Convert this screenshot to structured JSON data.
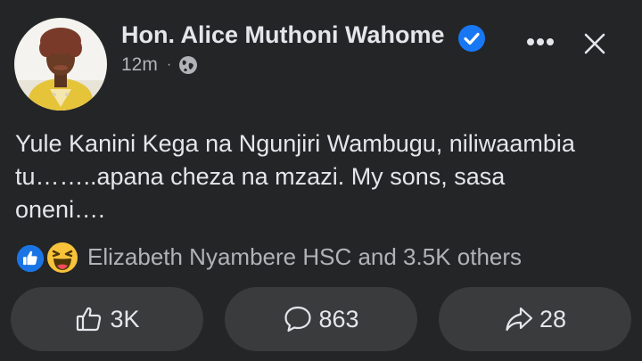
{
  "post": {
    "author": "Hon. Alice Muthoni Wahome",
    "time": "12m",
    "separator": "·",
    "text": "Yule Kanini Kega na Ngunjiri Wambugu, niliwaambia\ntu……..apana cheza na mzazi. My sons, sasa\noneni…."
  },
  "icons": {
    "verified": "verified-badge-icon",
    "privacy": "globe-icon",
    "more": "more-options-icon",
    "close": "close-icon",
    "reactions": [
      "like-reaction-icon",
      "haha-reaction-icon"
    ],
    "like": "thumbs-up-icon",
    "comment": "comment-bubble-icon",
    "share": "share-arrow-icon"
  },
  "reactions": {
    "summary": "Elizabeth Nyambere HSC and 3.5K others"
  },
  "actions": {
    "like_count": "3K",
    "comment_count": "863",
    "share_count": "28"
  },
  "colors": {
    "background": "#242526",
    "button_bg": "#3a3b3c",
    "text_primary": "#e4e6eb",
    "text_secondary": "#b0b3b8",
    "verified_blue": "#1877f2",
    "like_blue": "#1b74e4",
    "haha_yellow": "#f7c33a"
  }
}
